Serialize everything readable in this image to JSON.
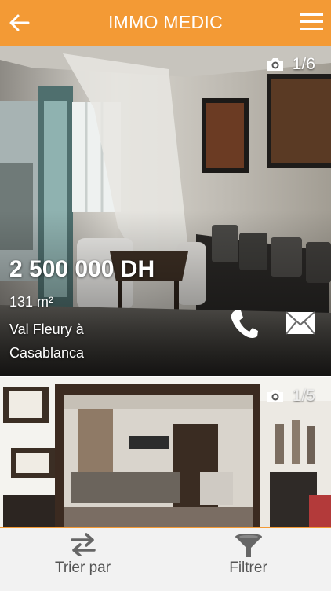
{
  "app": {
    "title": "IMMO MEDIC"
  },
  "colors": {
    "accent": "#f39a35",
    "bottom_bg": "#f2f2f2"
  },
  "icons": {
    "back": "arrow-left-icon",
    "menu": "hamburger-menu-icon",
    "photo_count": "camera-icon",
    "call": "phone-icon",
    "email": "envelope-icon",
    "sort": "sort-arrows-icon",
    "filter": "funnel-icon"
  },
  "listings": [
    {
      "photo_count": "1/6",
      "price": "2 500 000 DH",
      "area": "131 m²",
      "location": "Val Fleury à Casablanca"
    },
    {
      "photo_count": "1/5"
    }
  ],
  "bottom_bar": {
    "sort_label": "Trier par",
    "filter_label": "Filtrer"
  }
}
